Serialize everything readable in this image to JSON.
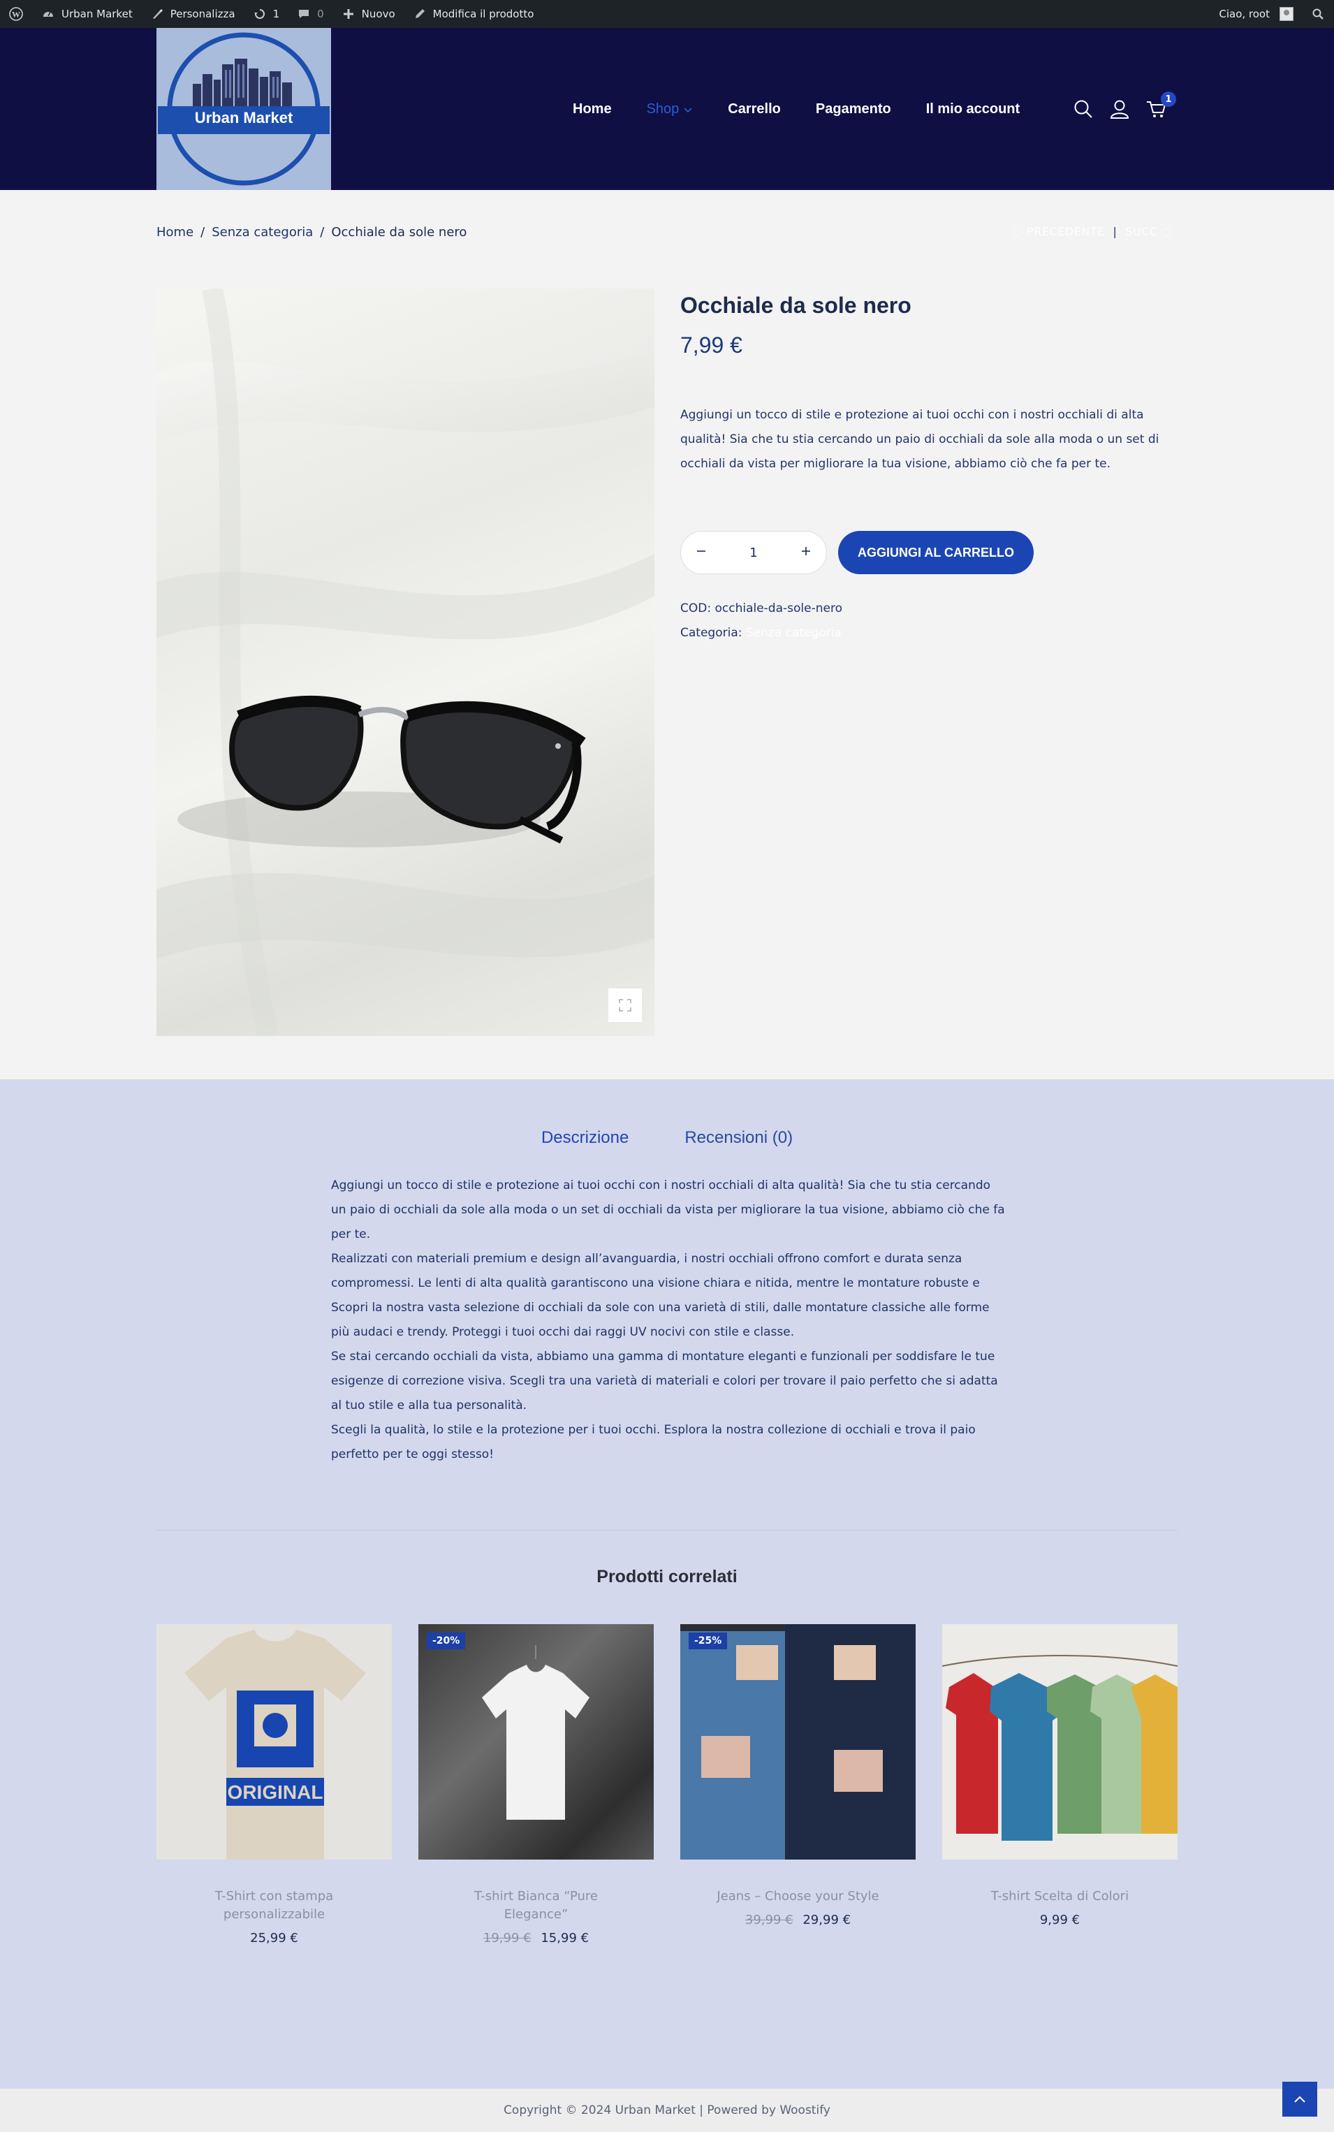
{
  "adminbar": {
    "site_name": "Urban Market",
    "customize": "Personalizza",
    "updates_count": "1",
    "comments_count": "0",
    "new_label": "Nuovo",
    "edit_label": "Modifica il prodotto",
    "greeting": "Ciao, root"
  },
  "header": {
    "logo_text": "Urban Market",
    "nav": [
      "Home",
      "Shop",
      "Carrello",
      "Pagamento",
      "Il mio account"
    ],
    "cart_count": "1",
    "accent": "#2248c6",
    "background": "#0f0f44"
  },
  "breadcrumb": {
    "items": [
      "Home",
      "Senza categoria",
      "Occhiale da sole nero"
    ],
    "separator": "/",
    "prev": "PRECEDENTE",
    "next": "SUCC"
  },
  "product": {
    "title": "Occhiale da sole nero",
    "price": "7,99 €",
    "short_description": "Aggiungi un tocco di stile e protezione ai tuoi occhi con i nostri occhiali di alta qualità! Sia che tu stia cercando un paio di occhiali da sole alla moda o un set di occhiali da vista per migliorare la tua visione, abbiamo ciò che fa per te.",
    "quantity": "1",
    "add_to_cart": "AGGIUNGI AL CARRELLO",
    "sku_label": "COD:",
    "sku": "occhiale-da-sole-nero",
    "category_label": "Categoria:",
    "category": "Senza categoria"
  },
  "tabs": {
    "description": "Descrizione",
    "reviews": "Recensioni (0)"
  },
  "description": [
    "Aggiungi un tocco di stile e protezione ai tuoi occhi con i nostri occhiali di alta qualità! Sia che tu stia cercando un paio di occhiali da sole alla moda o un set di occhiali da vista per migliorare la tua visione, abbiamo ciò che fa per te.",
    "Realizzati con materiali premium e design all’avanguardia, i nostri occhiali offrono comfort e durata senza compromessi. Le lenti di alta qualità garantiscono una visione chiara e nitida, mentre le montature robuste e",
    "Scopri la nostra vasta selezione di occhiali da sole con una varietà di stili, dalle montature classiche alle forme più audaci e trendy. Proteggi i tuoi occhi dai raggi UV nocivi con stile e classe.",
    "Se stai cercando occhiali da vista, abbiamo una gamma di montature eleganti e funzionali per soddisfare le tue esigenze di correzione visiva. Scegli tra una varietà di materiali e colori per trovare il paio perfetto che si adatta al tuo stile e alla tua personalità.",
    "Scegli la qualità, lo stile e la protezione per i tuoi occhi. Esplora la nostra collezione di occhiali e trova il paio perfetto per te oggi stesso!"
  ],
  "related": {
    "title": "Prodotti correlati",
    "items": [
      {
        "name": "T-Shirt con stampa personalizzabile",
        "old_price": "",
        "price": "25,99 €",
        "badge": ""
      },
      {
        "name": "T-shirt Bianca “Pure Elegance”",
        "old_price": "19,99 €",
        "price": "15,99 €",
        "badge": "-20%"
      },
      {
        "name": "Jeans – Choose your Style",
        "old_price": "39,99 €",
        "price": "29,99 €",
        "badge": "-25%"
      },
      {
        "name": "T-shirt Scelta di Colori",
        "old_price": "",
        "price": "9,99 €",
        "badge": ""
      }
    ]
  },
  "footer": {
    "copyright": "Copyright © 2024 Urban Market | Powered by Woostify"
  }
}
